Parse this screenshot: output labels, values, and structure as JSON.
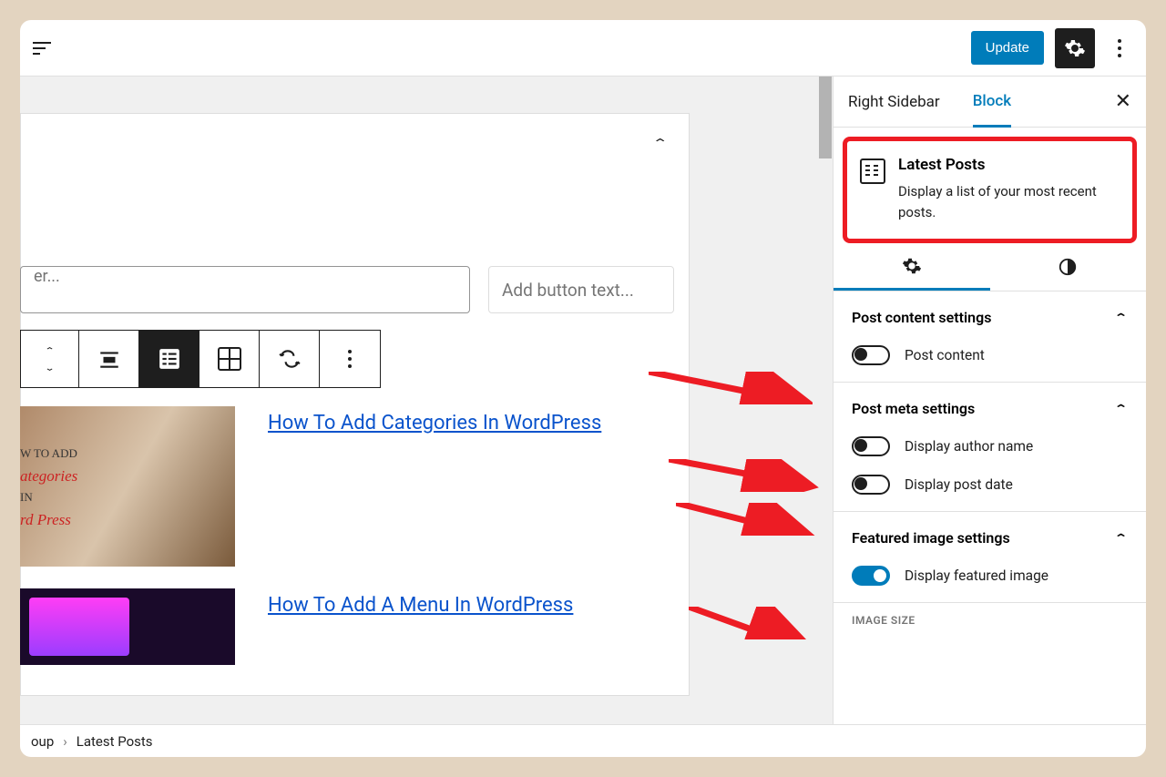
{
  "topbar": {
    "update": "Update"
  },
  "search": {
    "placeholder": "er...",
    "button": "Add button text..."
  },
  "posts": [
    {
      "title": "How To Add Categories In WordPress",
      "overlay": {
        "l1": "W TO ADD",
        "l2": "ategories",
        "l3": "IN",
        "l4": "rd Press"
      }
    },
    {
      "title": "How To Add A Menu In WordPress"
    }
  ],
  "sidebar": {
    "tabs": [
      "Right Sidebar",
      "Block"
    ],
    "block": {
      "title": "Latest Posts",
      "desc": "Display a list of your most recent posts."
    },
    "panels": {
      "content": {
        "title": "Post content settings",
        "toggle": "Post content"
      },
      "meta": {
        "title": "Post meta settings",
        "t1": "Display author name",
        "t2": "Display post date"
      },
      "featured": {
        "title": "Featured image settings",
        "toggle": "Display featured image"
      },
      "imgsize": "IMAGE SIZE"
    }
  },
  "breadcrumb": {
    "a": "oup",
    "b": "Latest Posts"
  }
}
